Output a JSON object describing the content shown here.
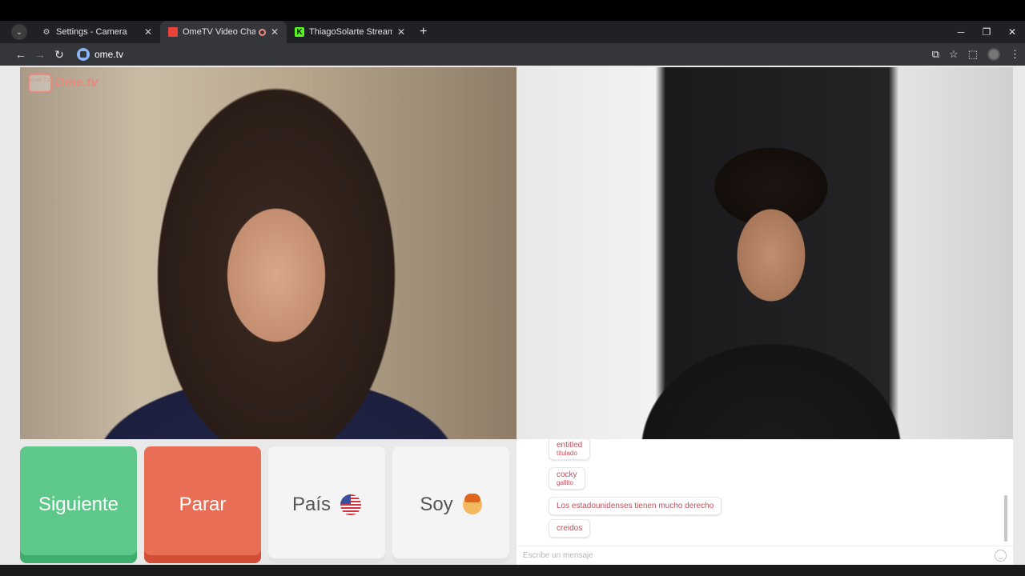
{
  "browser": {
    "tabs": [
      {
        "title": "Settings - Camera",
        "active": false
      },
      {
        "title": "OmeTV Video Chat — Ome",
        "active": true
      },
      {
        "title": "ThiagoSolarte Stream - Watch l",
        "active": false
      }
    ],
    "url": "ome.tv"
  },
  "app": {
    "logo_badge": "Ome TV",
    "logo_text": "Ome.tv",
    "buttons": {
      "next": "Siguiente",
      "stop": "Parar",
      "country": "País",
      "gender": "Soy"
    }
  },
  "chat": {
    "messages": [
      {
        "text": "entitled",
        "sub": "titulado"
      },
      {
        "text": "cocky",
        "sub": "gallito"
      },
      {
        "text": "Los estadounidenses tienen mucho derecho",
        "sub": ""
      },
      {
        "text": "creidos",
        "sub": ""
      }
    ],
    "input_placeholder": "Escribe un mensaje"
  },
  "colors": {
    "next_button": "#5ec88a",
    "stop_button": "#e96e56",
    "brand": "#e8897e",
    "chat_text": "#c0505b"
  }
}
